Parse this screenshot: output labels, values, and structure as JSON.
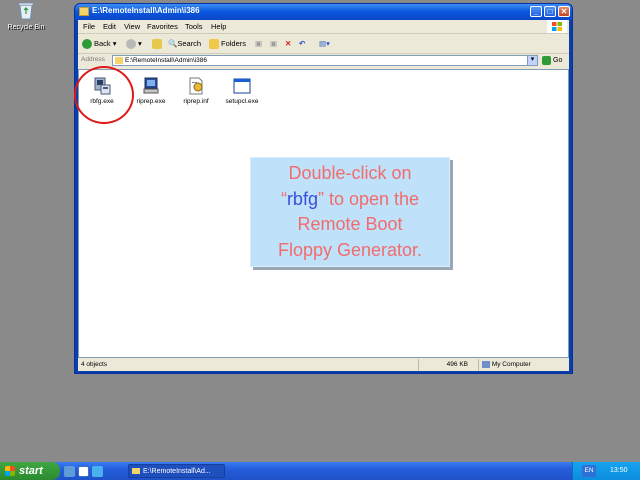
{
  "desktop": {
    "recycle_bin_label": "Recycle Bin"
  },
  "window": {
    "title": "E:\\RemoteInstall\\Admin\\i386",
    "buttons": {
      "minimize": "_",
      "maximize": "□",
      "close": "✕"
    },
    "menu": [
      "File",
      "Edit",
      "View",
      "Favorites",
      "Tools",
      "Help"
    ],
    "toolbar": {
      "back": "Back",
      "search": "Search",
      "folders": "Folders"
    },
    "address": {
      "label": "Address",
      "value": "E:\\RemoteInstall\\Admin\\i386",
      "go": "Go"
    },
    "files": [
      {
        "name": "rbfg.exe",
        "icon": "rbfg-app-icon"
      },
      {
        "name": "riprep.exe",
        "icon": "computer-app-icon"
      },
      {
        "name": "riprep.inf",
        "icon": "setup-info-icon"
      },
      {
        "name": "setupcl.exe",
        "icon": "window-app-icon"
      }
    ],
    "status": {
      "objects": "4 objects",
      "size": "496 KB",
      "location": "My Computer"
    }
  },
  "callout": {
    "line1": "Double-click on",
    "open_quote": "“",
    "highlight": "rbfg",
    "line2_rest": "” to open the",
    "line3": "Remote Boot",
    "line4": "Floppy Generator."
  },
  "taskbar": {
    "start_label": "start",
    "task_item": "E:\\RemoteInstall\\Ad...",
    "language": "EN",
    "clock": "13:50"
  },
  "colors": {
    "callout_bg": "#bfe1fa",
    "callout_text": "#f26c6c",
    "callout_highlight": "#3850d8",
    "highlight_circle": "#e01818"
  }
}
